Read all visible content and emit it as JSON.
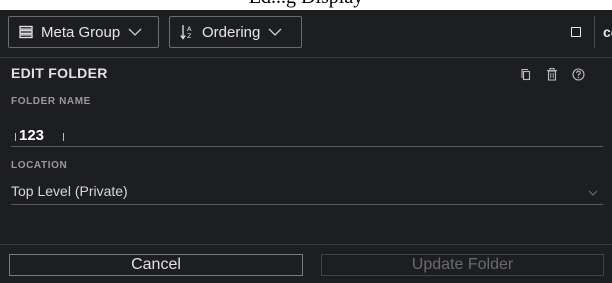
{
  "page_title": "Ed...g Display",
  "toolbar": {
    "meta_group_label": "Meta Group",
    "ordering_label": "Ordering",
    "cut_off_label": "co"
  },
  "edit_folder": {
    "title": "EDIT FOLDER",
    "header_icons": [
      "copy-icon",
      "trash-icon",
      "help-icon"
    ]
  },
  "folder_name": {
    "label": "FOLDER NAME",
    "value": "123"
  },
  "location": {
    "label": "LOCATION",
    "selected": "Top Level (Private)"
  },
  "actions": {
    "cancel_label": "Cancel",
    "update_label": "Update Folder"
  },
  "colors": {
    "panel_bg": "#1d1e20",
    "text": "#d4d4d4",
    "disabled_text": "#6a6a6a",
    "border": "#7a7a7a"
  }
}
